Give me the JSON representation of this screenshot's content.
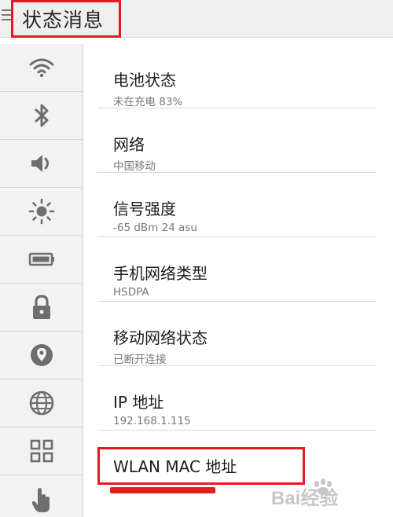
{
  "header": {
    "title": "状态消息"
  },
  "sidebar": {
    "items": [
      {
        "icon": "wifi-icon"
      },
      {
        "icon": "bluetooth-icon"
      },
      {
        "icon": "volume-icon"
      },
      {
        "icon": "brightness-icon"
      },
      {
        "icon": "battery-icon"
      },
      {
        "icon": "lock-icon"
      },
      {
        "icon": "location-icon"
      },
      {
        "icon": "globe-icon"
      },
      {
        "icon": "apps-grid-icon"
      },
      {
        "icon": "touch-hand-icon"
      }
    ]
  },
  "status": {
    "items": [
      {
        "title": "电池状态",
        "sub": "未在充电   83%"
      },
      {
        "title": "网络",
        "sub": "中国移动"
      },
      {
        "title": "信号强度",
        "sub": "-65 dBm   24 asu"
      },
      {
        "title": "手机网络类型",
        "sub": "HSDPA"
      },
      {
        "title": "移动网络状态",
        "sub": "已断开连接"
      },
      {
        "title": "IP 地址",
        "sub": "192.168.1.115"
      },
      {
        "title": "WLAN MAC 地址",
        "sub": ""
      }
    ]
  },
  "watermark": {
    "text": "Bai经验"
  },
  "colors": {
    "highlight": "#e5191f",
    "sidebar_bg": "#f2f2f2",
    "icon_gray": "#6e6e6e"
  }
}
